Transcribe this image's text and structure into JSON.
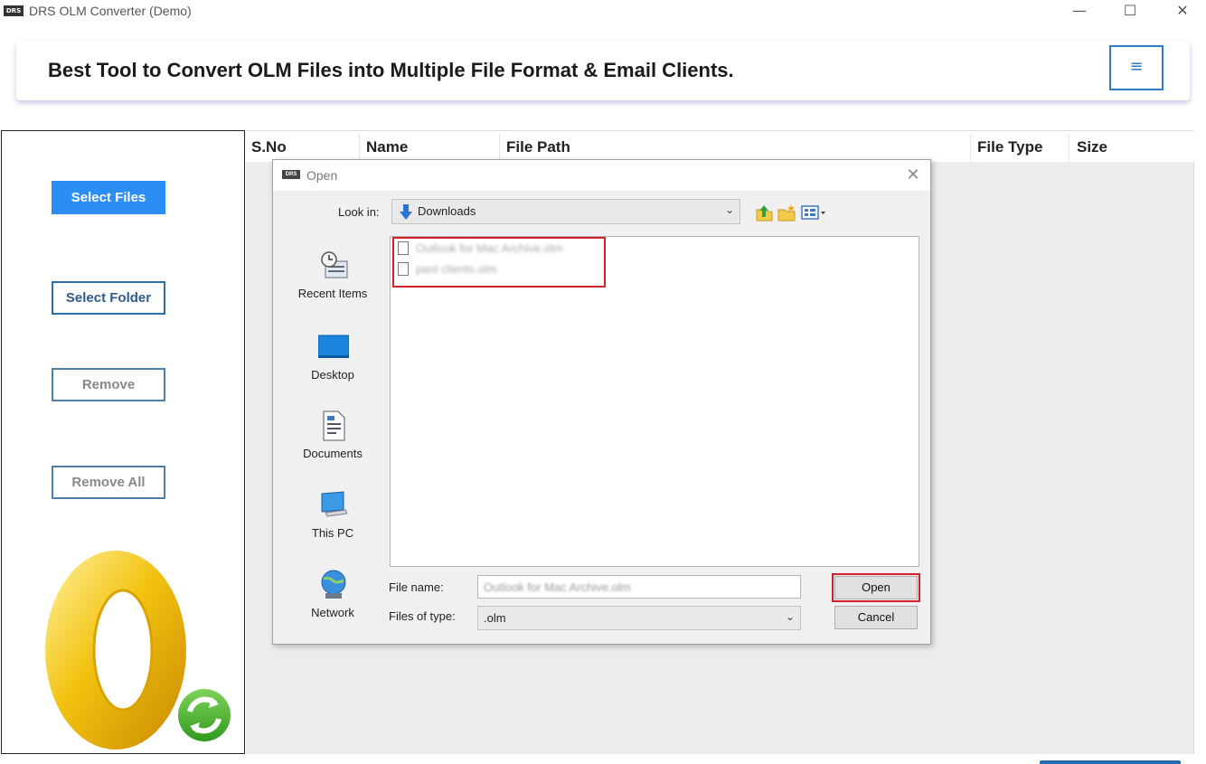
{
  "window": {
    "logo_text": "DRS",
    "title": "DRS OLM Converter (Demo)",
    "minimize_glyph": "—",
    "maximize_glyph": "☐",
    "close_glyph": "✕"
  },
  "banner": {
    "headline": "Best Tool to Convert OLM Files into Multiple File Format & Email Clients.",
    "menu_glyph": "≡"
  },
  "sidebar": {
    "select_files": "Select Files",
    "select_folder": "Select Folder",
    "remove": "Remove",
    "remove_all": "Remove All"
  },
  "table": {
    "columns": [
      "S.No",
      "Name",
      "File Path",
      "File Type",
      "Size"
    ]
  },
  "dialog": {
    "logo_text": "DRS",
    "title": "Open",
    "close_glyph": "✕",
    "look_in_label": "Look in:",
    "look_in_value": "Downloads",
    "places": [
      "Recent Items",
      "Desktop",
      "Documents",
      "This PC",
      "Network"
    ],
    "files": [
      "Outlook for Mac Archive.olm",
      "past clients.olm"
    ],
    "file_name_label": "File name:",
    "file_name_value": "Outlook for Mac Archive.olm",
    "file_type_label": "Files of type:",
    "file_type_value": ".olm",
    "open_button": "Open",
    "cancel_button": "Cancel"
  },
  "colors": {
    "primary": "#2b8ef4",
    "outline": "#2e6ea6",
    "highlight": "#d0202a"
  }
}
